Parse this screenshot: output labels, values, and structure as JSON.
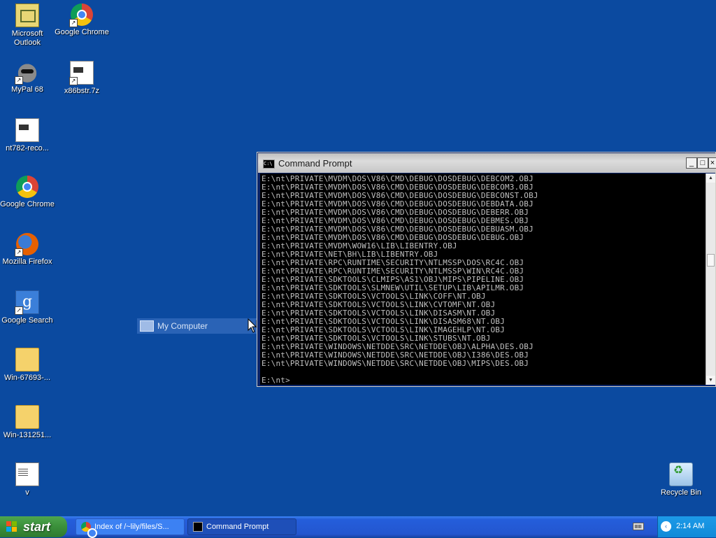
{
  "desktop": {
    "icons": [
      {
        "label": "Microsoft Outlook",
        "icon": "outlook-icon"
      },
      {
        "label": "Google Chrome",
        "icon": "chrome-icon"
      },
      {
        "label": "MyPal 68",
        "icon": "mypal-icon"
      },
      {
        "label": "x86bstr.7z",
        "icon": "archive-file-icon"
      },
      {
        "label": "nt782-reco...",
        "icon": "file-icon"
      },
      {
        "label": "Google Chrome",
        "icon": "chrome-icon"
      },
      {
        "label": "Mozilla Firefox",
        "icon": "firefox-icon"
      },
      {
        "label": "Google Search",
        "icon": "google-search-icon"
      },
      {
        "label": "Win-67693-...",
        "icon": "folder-icon"
      },
      {
        "label": "Win-131251...",
        "icon": "folder-icon"
      },
      {
        "label": "v",
        "icon": "text-file-icon"
      },
      {
        "label": "Recycle Bin",
        "icon": "recycle-bin-icon"
      }
    ],
    "drag_item": {
      "label": "My Computer",
      "icon": "my-computer-icon"
    }
  },
  "cmd_window": {
    "title": "Command Prompt",
    "icon_text": "C:\\",
    "buttons": {
      "minimize": "_",
      "maximize": "□",
      "close": "×"
    },
    "lines": [
      "E:\\nt\\PRIVATE\\MVDM\\DOS\\V86\\CMD\\DEBUG\\DOSDEBUG\\DEBCOM2.OBJ",
      "E:\\nt\\PRIVATE\\MVDM\\DOS\\V86\\CMD\\DEBUG\\DOSDEBUG\\DEBCOM3.OBJ",
      "E:\\nt\\PRIVATE\\MVDM\\DOS\\V86\\CMD\\DEBUG\\DOSDEBUG\\DEBCONST.OBJ",
      "E:\\nt\\PRIVATE\\MVDM\\DOS\\V86\\CMD\\DEBUG\\DOSDEBUG\\DEBDATA.OBJ",
      "E:\\nt\\PRIVATE\\MVDM\\DOS\\V86\\CMD\\DEBUG\\DOSDEBUG\\DEBERR.OBJ",
      "E:\\nt\\PRIVATE\\MVDM\\DOS\\V86\\CMD\\DEBUG\\DOSDEBUG\\DEBMES.OBJ",
      "E:\\nt\\PRIVATE\\MVDM\\DOS\\V86\\CMD\\DEBUG\\DOSDEBUG\\DEBUASM.OBJ",
      "E:\\nt\\PRIVATE\\MVDM\\DOS\\V86\\CMD\\DEBUG\\DOSDEBUG\\DEBUG.OBJ",
      "E:\\nt\\PRIVATE\\MVDM\\WOW16\\LIB\\LIBENTRY.OBJ",
      "E:\\nt\\PRIVATE\\NET\\BH\\LIB\\LIBENTRY.OBJ",
      "E:\\nt\\PRIVATE\\RPC\\RUNTIME\\SECURITY\\NTLMSSP\\DOS\\RC4C.OBJ",
      "E:\\nt\\PRIVATE\\RPC\\RUNTIME\\SECURITY\\NTLMSSP\\WIN\\RC4C.OBJ",
      "E:\\nt\\PRIVATE\\SDKTOOLS\\CLMIPS\\AS1\\OBJ\\MIPS\\PIPELINE.OBJ",
      "E:\\nt\\PRIVATE\\SDKTOOLS\\SLMNEW\\UTIL\\SETUP\\LIB\\APILMR.OBJ",
      "E:\\nt\\PRIVATE\\SDKTOOLS\\VCTOOLS\\LINK\\COFF\\NT.OBJ",
      "E:\\nt\\PRIVATE\\SDKTOOLS\\VCTOOLS\\LINK\\CVTOMF\\NT.OBJ",
      "E:\\nt\\PRIVATE\\SDKTOOLS\\VCTOOLS\\LINK\\DISASM\\NT.OBJ",
      "E:\\nt\\PRIVATE\\SDKTOOLS\\VCTOOLS\\LINK\\DISASM68\\NT.OBJ",
      "E:\\nt\\PRIVATE\\SDKTOOLS\\VCTOOLS\\LINK\\IMAGEHLP\\NT.OBJ",
      "E:\\nt\\PRIVATE\\SDKTOOLS\\VCTOOLS\\LINK\\STUBS\\NT.OBJ",
      "E:\\nt\\PRIVATE\\WINDOWS\\NETDDE\\SRC\\NETDDE\\OBJ\\ALPHA\\DES.OBJ",
      "E:\\nt\\PRIVATE\\WINDOWS\\NETDDE\\SRC\\NETDDE\\OBJ\\I386\\DES.OBJ",
      "E:\\nt\\PRIVATE\\WINDOWS\\NETDDE\\SRC\\NETDDE\\OBJ\\MIPS\\DES.OBJ",
      "",
      "E:\\nt>"
    ]
  },
  "taskbar": {
    "start_label": "start",
    "tasks": [
      {
        "label": "Index of /~lily/files/S...",
        "icon": "chrome-icon",
        "active": false
      },
      {
        "label": "Command Prompt",
        "icon": "cmd-icon",
        "active": true
      }
    ],
    "tray": {
      "clock": "2:14 AM",
      "expand_arrow": "‹"
    }
  },
  "colors": {
    "desktop": "#0b4aa0",
    "taskbar": "#245edb",
    "start": "#3a8f3a",
    "tray": "#0f8ad8",
    "console_bg": "#000000",
    "console_text": "#c0c0c0"
  }
}
